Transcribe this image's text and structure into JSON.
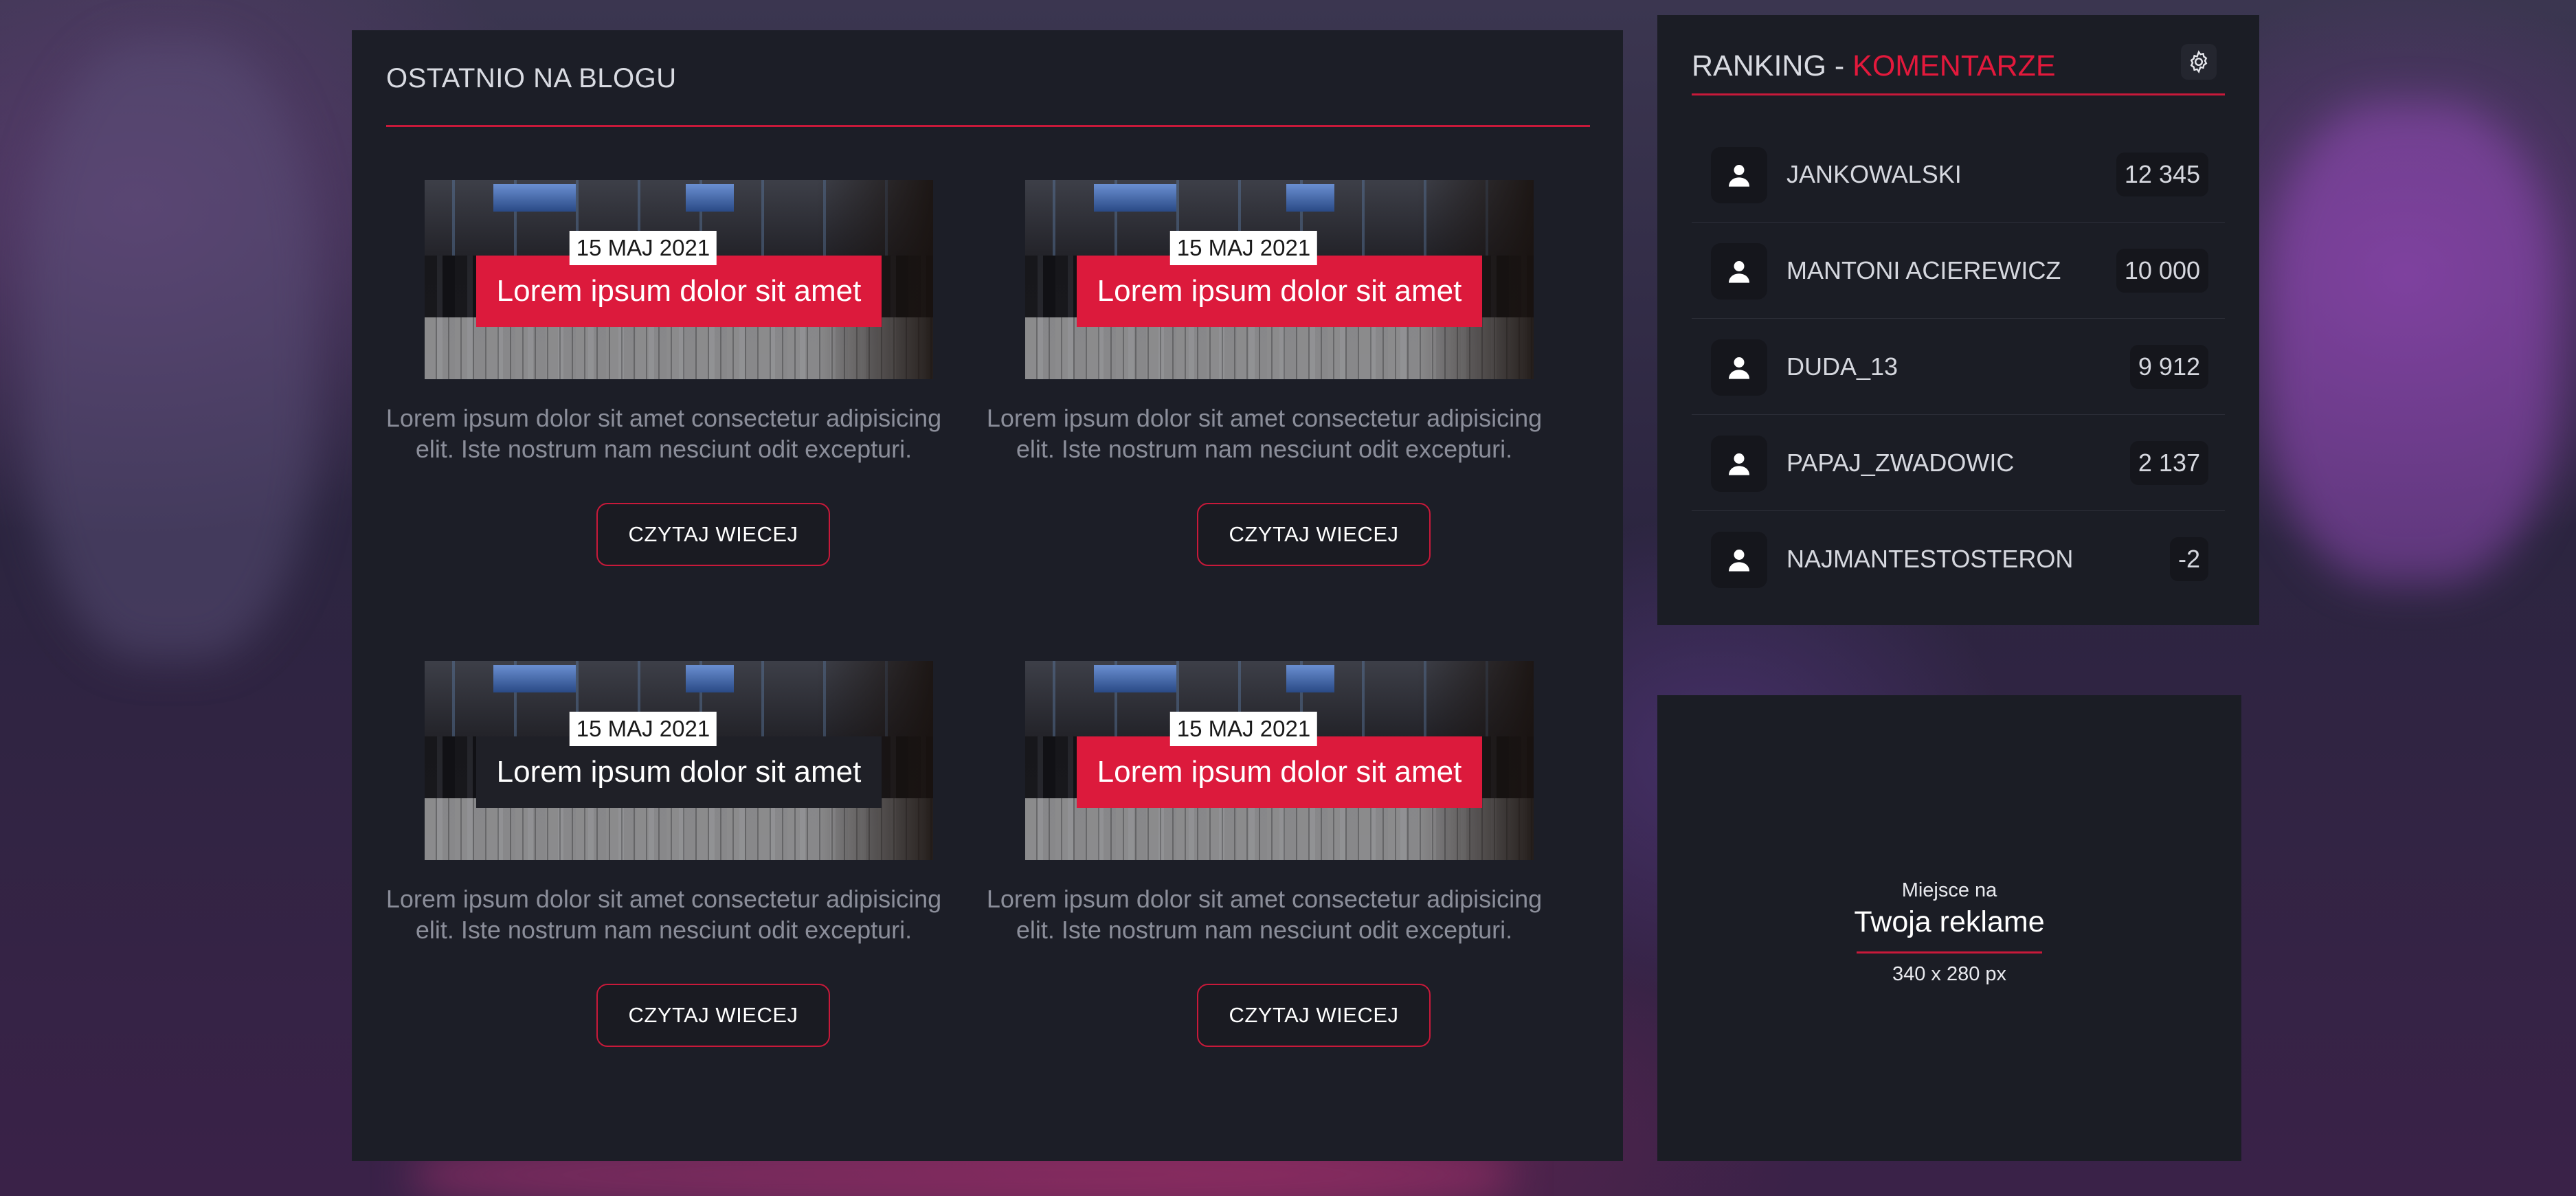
{
  "colors": {
    "accent": "#dc1a3c",
    "panel": "#1c1e27",
    "text_muted": "#8b8e9a"
  },
  "blog": {
    "title": "OSTATNIO NA BLOGU",
    "posts": [
      {
        "date": "15 MAJ 2021",
        "headline": "Lorem ipsum dolor sit amet",
        "excerpt": "Lorem ipsum dolor sit amet consectetur adipisicing elit. Iste nostrum nam nesciunt odit excepturi.",
        "button": "CZYTAJ WIECEJ"
      },
      {
        "date": "15 MAJ 2021",
        "headline": "Lorem ipsum dolor sit amet",
        "excerpt": "Lorem ipsum dolor sit amet consectetur adipisicing elit. Iste nostrum nam nesciunt odit excepturi.",
        "button": "CZYTAJ WIECEJ"
      },
      {
        "date": "15 MAJ 2021",
        "headline": "Lorem ipsum dolor sit amet",
        "excerpt": "Lorem ipsum dolor sit amet consectetur adipisicing elit. Iste nostrum nam nesciunt odit excepturi.",
        "button": "CZYTAJ WIECEJ"
      },
      {
        "date": "15 MAJ 2021",
        "headline": "Lorem ipsum dolor sit amet",
        "excerpt": "Lorem ipsum dolor sit amet consectetur adipisicing elit. Iste nostrum nam nesciunt odit excepturi.",
        "button": "CZYTAJ WIECEJ"
      }
    ]
  },
  "ranking": {
    "title_prefix": "RANKING - ",
    "title_accent": "KOMENTARZE",
    "settings_icon": "gear-icon",
    "entries": [
      {
        "name": "JANKOWALSKI",
        "score": "12 345"
      },
      {
        "name": "MANTONI ACIEREWICZ",
        "score": "10 000"
      },
      {
        "name": "DUDA_13",
        "score": "9 912"
      },
      {
        "name": "PAPAJ_ZWADOWIC",
        "score": "2 137"
      },
      {
        "name": "NAJMANTESTOSTERON",
        "score": "-2"
      }
    ]
  },
  "ad": {
    "line1": "Miejsce na",
    "line2": "Twoja reklame",
    "line3": "340 x 280 px"
  }
}
